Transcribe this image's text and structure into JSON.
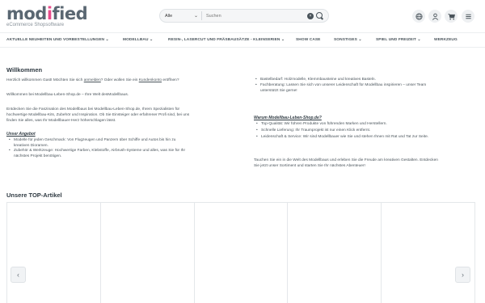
{
  "header": {
    "logo_part1": "mod",
    "logo_accent": "i",
    "logo_part2": "fied",
    "logo_sub": "eCommerce Shopsoftware",
    "search_category": "Alle",
    "search_placeholder": "Suchen",
    "icons": [
      "globe-icon",
      "user-icon",
      "cart-icon",
      "menu-icon"
    ]
  },
  "nav": {
    "items": [
      "AKTUELLE NEUHEITEN UND VORBESTELLUNGEN ⌄",
      "MODELLBAU ⌄",
      "RESIN-, LASERCUT UND FRÄSBAUSÄTZE - KLEINSERIEN ⌄",
      "SHOW CASE",
      "SONSTIGES ⌄",
      "SPIEL UND FREIZEIT ⌄",
      "WERKZEUG"
    ]
  },
  "welcome": {
    "title": "Willkommen",
    "greeting_pre": "Herzlich willkommen Gast! Möchten Sie sich ",
    "greeting_link1": "anmelden",
    "greeting_mid": "? Oder wollen Sie ein ",
    "greeting_link2": "Kundenkonto",
    "greeting_post": " eröffnen?",
    "line2": "Willkommen bei Modellbau-Leben-Shop.de – Ihre Welt desModellbaus.",
    "para3_l1": "Entdecken Sie die Faszination des Modellbaus bei Modellbau-Leben-Shop.de, Ihrem Spezialisten für",
    "para3_l2": "hochwertige Modellbau-Kits, Zubehör und Inspiration. Ob Sie Einsteiger oder erfahrener Profi sind, bei uns",
    "para3_l3": "finden Sie alles, was Ihr Modellbauer-Herz höherschlagen lässt.",
    "offer_title": "Unser Angebot",
    "offer_item1_l1": "Modelle für jeden Geschmack: Von Flugzeugen und Panzern über Schiffe und Autos bis hin zu",
    "offer_item1_l2": "kreativen Dioramen.",
    "offer_item2_l1": "Zubehör & Werkzeuge: Hochwertige Farben, Klebstoffe, Airbrush-Systeme und alles, was Sie für Ihr",
    "offer_item2_l2": "nächstes Projekt benötigen.",
    "right_item1": "Bastelbedarf: Holzmodelle, Klemmbausteine und kreatives Basteln.",
    "right_item2_l1": "Fachberatung: Lassen Sie sich von unserer Leidenschaft für Modellbau inspirieren – unser Team",
    "right_item2_l2": "unterstützt Sie gerne!",
    "why_title": "Warum Modellbau-Leben-Shop.de?",
    "why_item1": "Top-Qualität: Wir führen Produkte von führenden Marken und Herstellern.",
    "why_item2": "Schnelle Lieferung: Ihr Traumprojekt ist nur einen Klick entfernt.",
    "why_item3": "Leidenschaft & Service: Wir sind Modellbauer wie Sie und stehen Ihnen mit Rat und Tat zur Seite.",
    "closing_l1": "Tauchen Sie ein in die Welt des Modellbaus und erleben Sie die Freude am kreativen Gestalten. Entdecken",
    "closing_l2": "Sie jetzt unser Sortiment und starten Sie Ihr nächstes Abenteuer!"
  },
  "top_articles": {
    "title": "Unsere TOP-Artikel",
    "prev": "‹",
    "next": "›"
  }
}
